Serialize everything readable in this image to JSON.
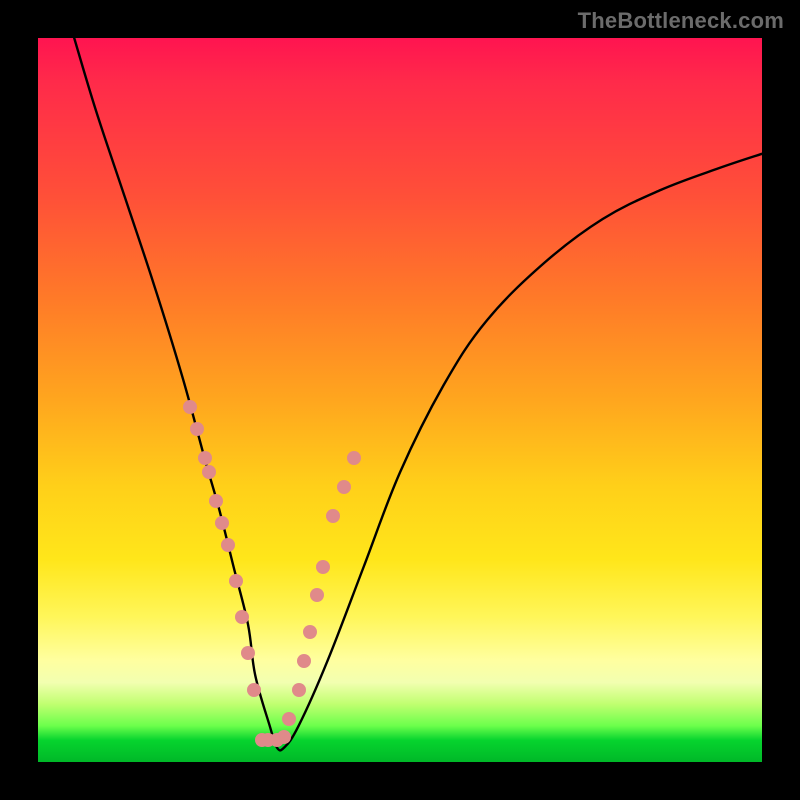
{
  "branding": {
    "watermark": "TheBottleneck.com"
  },
  "chart_data": {
    "type": "line",
    "title": "",
    "xlabel": "",
    "ylabel": "",
    "xlim": [
      0,
      100
    ],
    "ylim": [
      0,
      100
    ],
    "grid": false,
    "legend": false,
    "series": [
      {
        "name": "bottleneck-curve",
        "x": [
          5,
          8,
          12,
          16,
          20,
          23,
          25,
          27,
          29,
          30,
          32,
          33,
          34,
          36,
          40,
          45,
          50,
          56,
          62,
          70,
          78,
          86,
          94,
          100
        ],
        "y": [
          100,
          90,
          78,
          66,
          53,
          42,
          35,
          27,
          19,
          12,
          5,
          2,
          2,
          5,
          14,
          27,
          40,
          52,
          61,
          69,
          75,
          79,
          82,
          84
        ]
      }
    ],
    "annotations": {
      "points_overlay": {
        "name": "highlighted-dots",
        "x": [
          21.0,
          22.0,
          23.0,
          23.6,
          24.6,
          25.4,
          26.2,
          27.4,
          28.2,
          29.0,
          29.8,
          31.0,
          31.8,
          33.0,
          34.0,
          34.6,
          36.0,
          36.8,
          37.6,
          38.6,
          39.4,
          40.8,
          42.2,
          43.6
        ],
        "y": [
          49.0,
          46.0,
          42.0,
          40.0,
          36.0,
          33.0,
          30.0,
          25.0,
          20.0,
          15.0,
          10.0,
          3.0,
          3.0,
          3.0,
          3.5,
          6.0,
          10.0,
          14.0,
          18.0,
          23.0,
          27.0,
          34.0,
          38.0,
          42.0
        ]
      }
    },
    "background": {
      "type": "vertical-gradient",
      "stops": [
        {
          "pos": 0.0,
          "color": "#ff1450"
        },
        {
          "pos": 0.5,
          "color": "#ffa61e"
        },
        {
          "pos": 0.8,
          "color": "#fff65a"
        },
        {
          "pos": 1.0,
          "color": "#00b828"
        }
      ]
    }
  }
}
